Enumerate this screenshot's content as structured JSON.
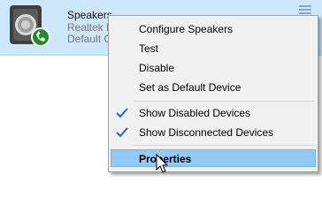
{
  "device": {
    "name": "Speakers",
    "line1": "Realtek H",
    "line2": "Default C"
  },
  "context_menu": {
    "items": [
      {
        "label": "Configure Speakers"
      },
      {
        "label": "Test"
      },
      {
        "label": "Disable"
      },
      {
        "label": "Set as Default Device"
      },
      {
        "label": "Show Disabled Devices",
        "checked": true
      },
      {
        "label": "Show Disconnected Devices",
        "checked": true
      },
      {
        "label": "Properties",
        "bold": true,
        "highlighted": true
      }
    ]
  },
  "colors": {
    "selection": "#cfe7fb",
    "menu_highlight": "#91c9f7",
    "check": "#2a62c9",
    "default_badge": "#1f8a2e"
  },
  "icons": {
    "device": "speaker-icon",
    "badge": "phone-check-icon",
    "level": "level-bars-icon",
    "check": "checkmark-icon",
    "cursor": "mouse-pointer-icon"
  }
}
